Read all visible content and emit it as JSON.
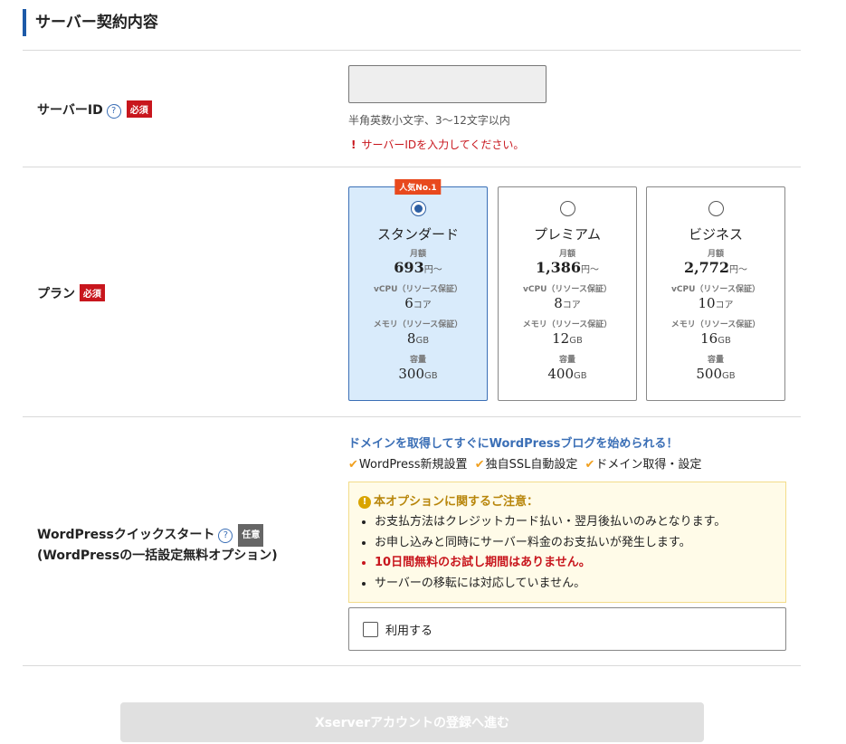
{
  "section": {
    "title": "サーバー契約内容"
  },
  "server_id": {
    "label": "サーバーID",
    "required": "必須",
    "help": "?",
    "value": "",
    "hint": "半角英数小文字、3〜12文字以内",
    "error_mark": "!",
    "error": "サーバーIDを入力してください。"
  },
  "plan": {
    "label": "プラン",
    "required": "必須",
    "plans": [
      {
        "badge": "人気No.1",
        "name": "スタンダード",
        "price_label": "月額",
        "price": "693",
        "price_unit": "円〜",
        "cpu_label": "vCPU（リソース保証）",
        "cpu": "6",
        "cpu_unit": "コア",
        "mem_label": "メモリ（リソース保証）",
        "mem": "8",
        "mem_unit": "GB",
        "disk_label": "容量",
        "disk": "300",
        "disk_unit": "GB",
        "selected": true
      },
      {
        "badge": "",
        "name": "プレミアム",
        "price_label": "月額",
        "price": "1,386",
        "price_unit": "円〜",
        "cpu_label": "vCPU（リソース保証）",
        "cpu": "8",
        "cpu_unit": "コア",
        "mem_label": "メモリ（リソース保証）",
        "mem": "12",
        "mem_unit": "GB",
        "disk_label": "容量",
        "disk": "400",
        "disk_unit": "GB",
        "selected": false
      },
      {
        "badge": "",
        "name": "ビジネス",
        "price_label": "月額",
        "price": "2,772",
        "price_unit": "円〜",
        "cpu_label": "vCPU（リソース保証）",
        "cpu": "10",
        "cpu_unit": "コア",
        "mem_label": "メモリ（リソース保証）",
        "mem": "16",
        "mem_unit": "GB",
        "disk_label": "容量",
        "disk": "500",
        "disk_unit": "GB",
        "selected": false
      }
    ]
  },
  "wordpress": {
    "label_line1": "WordPressクイックスタート",
    "label_line2": "(WordPressの一括設定無料オプション)",
    "help": "?",
    "optional": "任意",
    "promo": "ドメインを取得してすぐにWordPressブログを始められる！",
    "features": [
      "WordPress新規設置",
      "独自SSL自動設定",
      "ドメイン取得・設定"
    ],
    "notice_icon": "!",
    "notice_title": "本オプションに関するご注意：",
    "notices": [
      "お支払方法はクレジットカード払い・翌月後払いのみとなります。",
      "お申し込みと同時にサーバー料金のお支払いが発生します。",
      "10日間無料のお試し期間はありません。",
      "サーバーの移転には対応していません。"
    ],
    "use_label": "利用する",
    "use_checked": false
  },
  "submit": {
    "label": "Xserverアカウントの登録へ進む"
  },
  "colors": {
    "accent": "#1d5aa8",
    "required": "#c8161d",
    "selected_bg": "#d9ebfb",
    "check": "#f0a020"
  }
}
